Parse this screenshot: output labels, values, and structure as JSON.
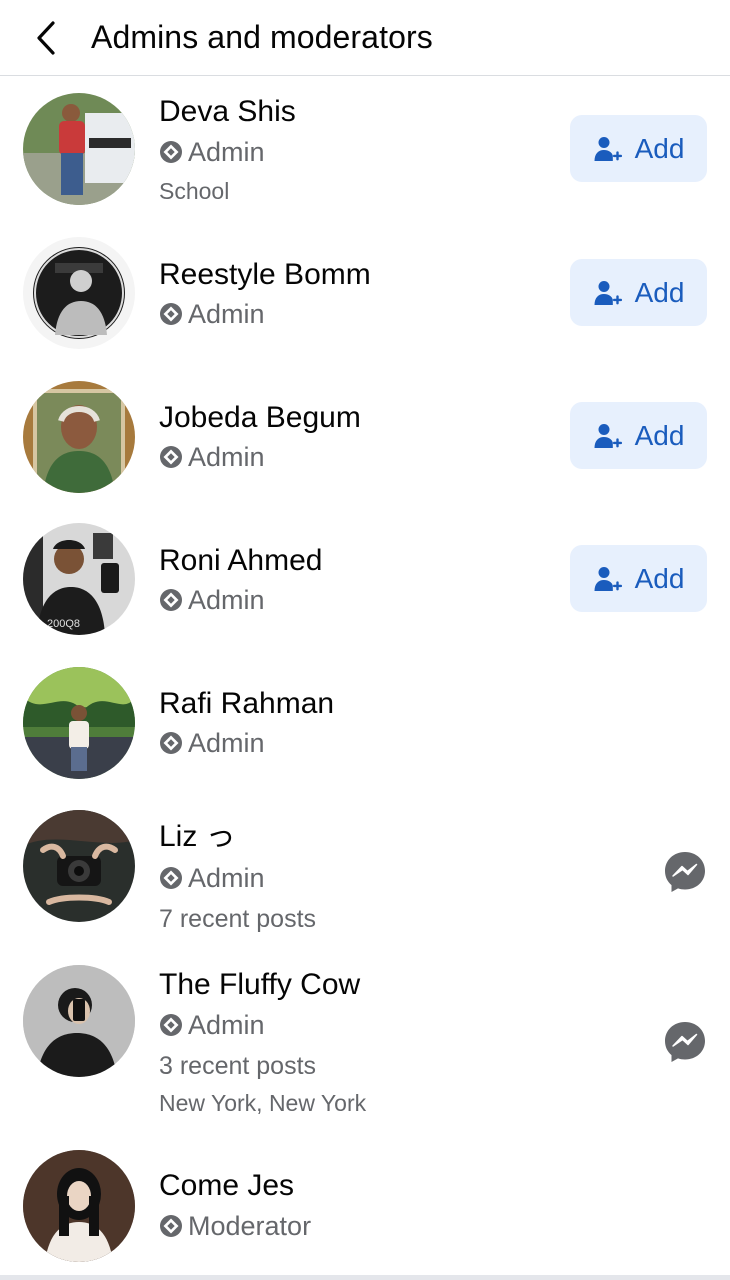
{
  "header": {
    "title": "Admins and moderators",
    "back_icon": "chevron-left-icon"
  },
  "colors": {
    "accent": "#1a5cbd",
    "button_bg": "#e7f0fd",
    "secondary_text": "#65676b",
    "primary_text": "#050505",
    "messenger_icon": "#65676b"
  },
  "members": [
    {
      "name": "Deva Shis",
      "role": "Admin",
      "lines": [
        "School"
      ],
      "action": "add",
      "action_label": "Add"
    },
    {
      "name": "Reestyle Bomm",
      "role": "Admin",
      "lines": [],
      "action": "add",
      "action_label": "Add"
    },
    {
      "name": "Jobeda Begum",
      "role": "Admin",
      "lines": [],
      "action": "add",
      "action_label": "Add"
    },
    {
      "name": "Roni Ahmed",
      "role": "Admin",
      "lines": [],
      "action": "add",
      "action_label": "Add"
    },
    {
      "name": "Rafi Rahman",
      "role": "Admin",
      "lines": [],
      "action": "none"
    },
    {
      "name": "Liz っ",
      "role": "Admin",
      "lines": [
        "7 recent posts"
      ],
      "action": "message",
      "action_icon": "messenger-icon"
    },
    {
      "name": "The Fluffy Cow",
      "role": "Admin",
      "lines": [
        "3 recent posts",
        "New York, New York"
      ],
      "action": "message",
      "action_icon": "messenger-icon"
    },
    {
      "name": "Come Jes",
      "role": "Moderator",
      "lines": [],
      "action": "none"
    }
  ]
}
